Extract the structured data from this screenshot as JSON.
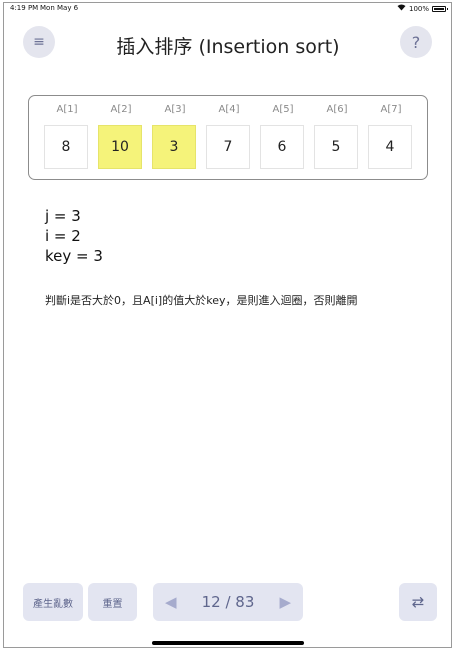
{
  "status_bar": {
    "time": "4:19 PM",
    "date": "Mon May 6",
    "battery": "100%"
  },
  "header": {
    "title": "插入排序 (Insertion sort)",
    "menu_glyph": "≡",
    "help_glyph": "?"
  },
  "array": {
    "cells": [
      {
        "label": "A[1]",
        "value": "8",
        "highlighted": false
      },
      {
        "label": "A[2]",
        "value": "10",
        "highlighted": true
      },
      {
        "label": "A[3]",
        "value": "3",
        "highlighted": true
      },
      {
        "label": "A[4]",
        "value": "7",
        "highlighted": false
      },
      {
        "label": "A[5]",
        "value": "6",
        "highlighted": false
      },
      {
        "label": "A[6]",
        "value": "5",
        "highlighted": false
      },
      {
        "label": "A[7]",
        "value": "4",
        "highlighted": false
      }
    ],
    "highlight_color": "#f5f37a"
  },
  "state": {
    "j": "j = 3",
    "i": "i = 2",
    "key": "key = 3"
  },
  "description": "判斷i是否大於0，且A[i]的值大於key，是則進入迴圈，否則離開",
  "toolbar": {
    "random_label": "產生亂數",
    "reset_label": "重置",
    "prev_glyph": "◀",
    "page": "12 / 83",
    "next_glyph": "▶",
    "swap_glyph": "⇄"
  }
}
